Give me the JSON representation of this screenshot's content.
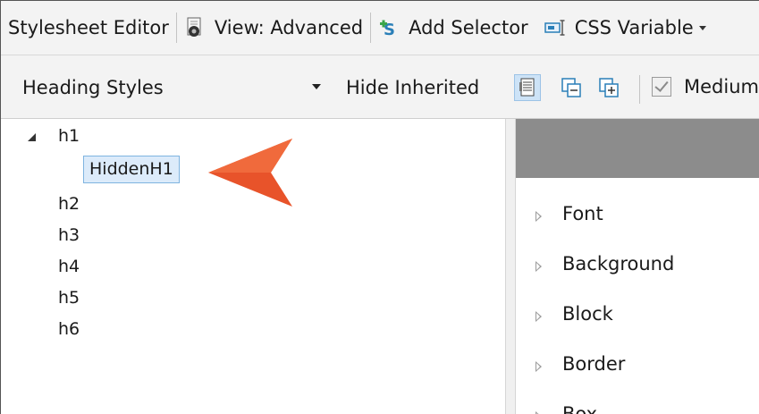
{
  "toolbar": {
    "title": "Stylesheet Editor",
    "view_label": "View: Advanced",
    "add_selector_label": "Add Selector",
    "css_variable_label": "CSS Variable"
  },
  "filterbar": {
    "combo_value": "Heading Styles",
    "hide_inherited_label": "Hide Inherited",
    "medium_label": "Medium"
  },
  "tree": {
    "items": [
      {
        "label": "h1"
      },
      {
        "label": "HiddenH1"
      },
      {
        "label": "h2"
      },
      {
        "label": "h3"
      },
      {
        "label": "h4"
      },
      {
        "label": "h5"
      },
      {
        "label": "h6"
      }
    ]
  },
  "properties": {
    "groups": [
      {
        "label": "Font"
      },
      {
        "label": "Background"
      },
      {
        "label": "Block"
      },
      {
        "label": "Border"
      },
      {
        "label": "Box"
      }
    ]
  },
  "colors": {
    "callout_arrow": "#e8532a",
    "selection_bg": "#dcebfa",
    "selection_border": "#7fb4e0",
    "header_gray": "#8c8c8c"
  },
  "icons": {
    "view": "eye-document-icon",
    "add_selector": "add-selector-icon",
    "css_variable": "css-variable-icon",
    "toggle_preview": "document-preview-icon",
    "collapse": "collapse-all-icon",
    "expand": "expand-all-icon"
  }
}
